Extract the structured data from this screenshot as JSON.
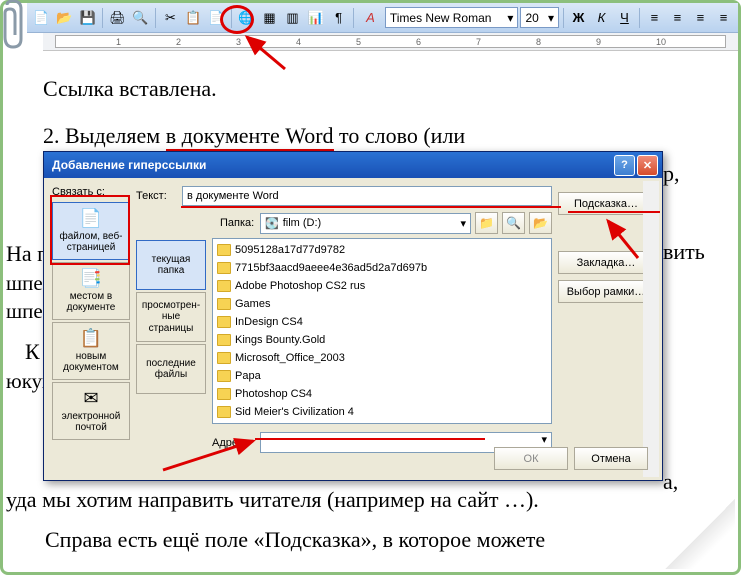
{
  "toolbar": {
    "font_name": "Times New Roman",
    "font_size": "20",
    "bold": "Ж",
    "italic": "К",
    "underline": "Ч"
  },
  "doc": {
    "line1": "Ссылка вставлена.",
    "line2a": "2. Выделяем ",
    "line2b": "в документе Word",
    "line2c": " то слово (или",
    "line3_tail": "р,",
    "line4_tail": "вить",
    "line5_post": "уда мы хотим направить читателя (например на сайт …).",
    "line6": "Справа есть ещё поле «Подсказка», в которое можете",
    "left_snip1": "На п",
    "left_snip2": "шпел",
    "left_snip3": "шпер",
    "left_snip4": "К",
    "left_snip5": "юкум",
    "right_snip1": "а,"
  },
  "dialog": {
    "title": "Добавление гиперссылки",
    "link_with": "Связать с:",
    "text_label": "Текст:",
    "text_value": "в документе Word",
    "folder_label": "Папка:",
    "folder_value": "film (D:)",
    "link_opts": {
      "file_web": "файлом, веб-страницей",
      "place_doc": "местом в документе",
      "new_doc": "новым документом",
      "email": "электронной почтой"
    },
    "tabs": {
      "current": "текущая папка",
      "browsed": "просмотрен-ные страницы",
      "recent": "последние файлы"
    },
    "files": [
      "5095128a17d77d9782",
      "7715bf3aacd9aeee4e36ad5d2a7d697b",
      "Adobe Photoshop CS2 rus",
      "Games",
      "InDesign CS4",
      "Kings Bounty.Gold",
      "Microsoft_Office_2003",
      "Papa",
      "Photoshop CS4",
      "Sid Meier's Civilization 4"
    ],
    "address_label": "Адрес:",
    "btn_hint": "Подсказка…",
    "btn_bookmark": "Закладка…",
    "btn_frame": "Выбор рамки…",
    "btn_ok": "ОК",
    "btn_cancel": "Отмена"
  }
}
